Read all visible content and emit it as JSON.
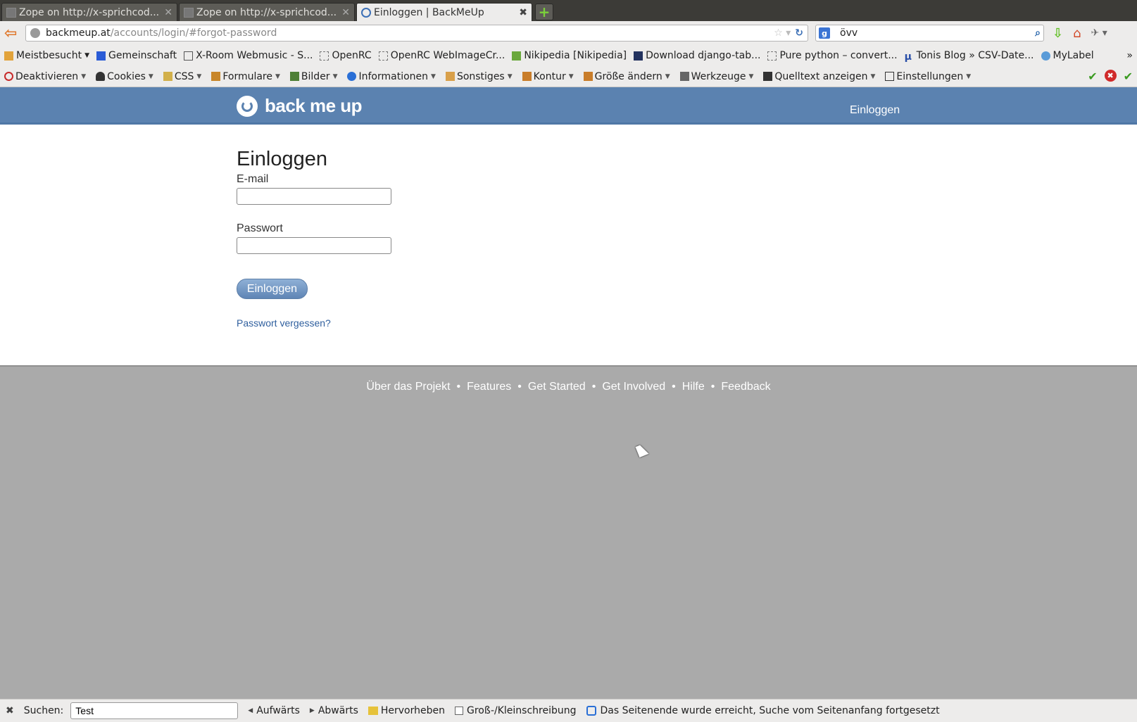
{
  "browser": {
    "tabs": [
      {
        "title": "Zope on http://x-sprichcod...",
        "active": false
      },
      {
        "title": "Zope on http://x-sprichcod...",
        "active": false
      },
      {
        "title": "Einloggen | BackMeUp",
        "active": true
      }
    ],
    "url": {
      "host": "backmeup.at",
      "path": "/accounts/login/#forgot-password"
    },
    "search": {
      "value": "övv",
      "engine_icon": "google-icon"
    },
    "bookmarks": [
      {
        "label": "Meistbesucht",
        "icon": "folder-icon",
        "dropdown": true
      },
      {
        "label": "Gemeinschaft",
        "icon": "g-icon"
      },
      {
        "label": "X-Room Webmusic - S...",
        "icon": "bar-icon"
      },
      {
        "label": "OpenRC",
        "icon": "page-icon"
      },
      {
        "label": "OpenRC WebImageCr...",
        "icon": "page-icon"
      },
      {
        "label": "Nikipedia [Nikipedia]",
        "icon": "leaf-icon"
      },
      {
        "label": "Download django-tab...",
        "icon": "s-icon"
      },
      {
        "label": "Pure python – convert...",
        "icon": "page-icon"
      },
      {
        "label": "Tonis Blog » CSV-Date...",
        "icon": "mu-icon"
      },
      {
        "label": "MyLabel",
        "icon": "mylabel-icon"
      }
    ],
    "bookmarks_more": "»",
    "devtoolbar": [
      {
        "label": "Deaktivieren",
        "icon": "disable-icon"
      },
      {
        "label": "Cookies",
        "icon": "cookie-icon"
      },
      {
        "label": "CSS",
        "icon": "css-icon"
      },
      {
        "label": "Formulare",
        "icon": "form-icon"
      },
      {
        "label": "Bilder",
        "icon": "image-icon"
      },
      {
        "label": "Informationen",
        "icon": "info-icon"
      },
      {
        "label": "Sonstiges",
        "icon": "misc-icon"
      },
      {
        "label": "Kontur",
        "icon": "outline-icon"
      },
      {
        "label": "Größe ändern",
        "icon": "resize-icon"
      },
      {
        "label": "Werkzeuge",
        "icon": "tools-icon"
      },
      {
        "label": "Quelltext anzeigen",
        "icon": "source-icon"
      },
      {
        "label": "Einstellungen",
        "icon": "settings-icon"
      }
    ]
  },
  "site": {
    "brand": "back me up",
    "header_login": "Einloggen",
    "login": {
      "heading": "Einloggen",
      "email_label": "E-mail",
      "email_value": "",
      "password_label": "Passwort",
      "password_value": "",
      "submit_label": "Einloggen",
      "forgot_label": "Passwort vergessen?"
    },
    "footer": [
      "Über das Projekt",
      "Features",
      "Get Started",
      "Get Involved",
      "Hilfe",
      "Feedback"
    ],
    "footer_separator": "•",
    "colors": {
      "header": "#5b82b0",
      "link": "#2f5f9e",
      "footer_bg": "#aaaaaa"
    }
  },
  "findbar": {
    "label": "Suchen:",
    "value": "Test",
    "up": "Aufwärts",
    "down": "Abwärts",
    "highlight": "Hervorheben",
    "match_case": "Groß-/Kleinschreibung",
    "match_case_checked": false,
    "status": "Das Seitenende wurde erreicht, Suche vom Seitenanfang fortgesetzt"
  }
}
